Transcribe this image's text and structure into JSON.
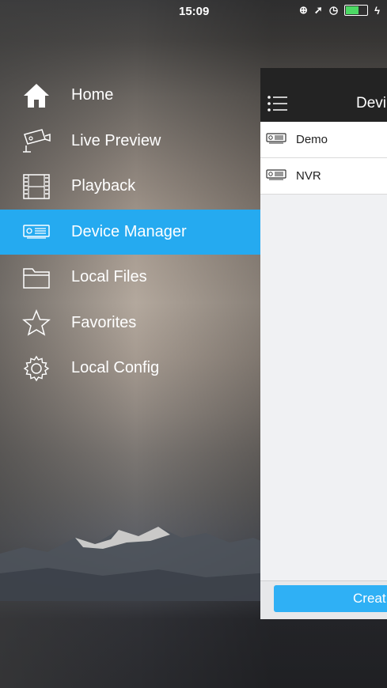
{
  "status": {
    "time": "15:09"
  },
  "menu": {
    "items": [
      {
        "label": "Home",
        "icon": "home-icon",
        "active": false
      },
      {
        "label": "Live Preview",
        "icon": "camera-icon",
        "active": false
      },
      {
        "label": "Playback",
        "icon": "film-icon",
        "active": false
      },
      {
        "label": "Device Manager",
        "icon": "device-icon",
        "active": true
      },
      {
        "label": "Local Files",
        "icon": "folder-icon",
        "active": false
      },
      {
        "label": "Favorites",
        "icon": "star-icon",
        "active": false
      },
      {
        "label": "Local Config",
        "icon": "gear-icon",
        "active": false
      }
    ]
  },
  "panel": {
    "title": "Devi",
    "devices": [
      {
        "name": "Demo"
      },
      {
        "name": "NVR"
      }
    ],
    "create_label": "Creat"
  },
  "colors": {
    "accent": "#25aaf0",
    "header": "#232323"
  }
}
